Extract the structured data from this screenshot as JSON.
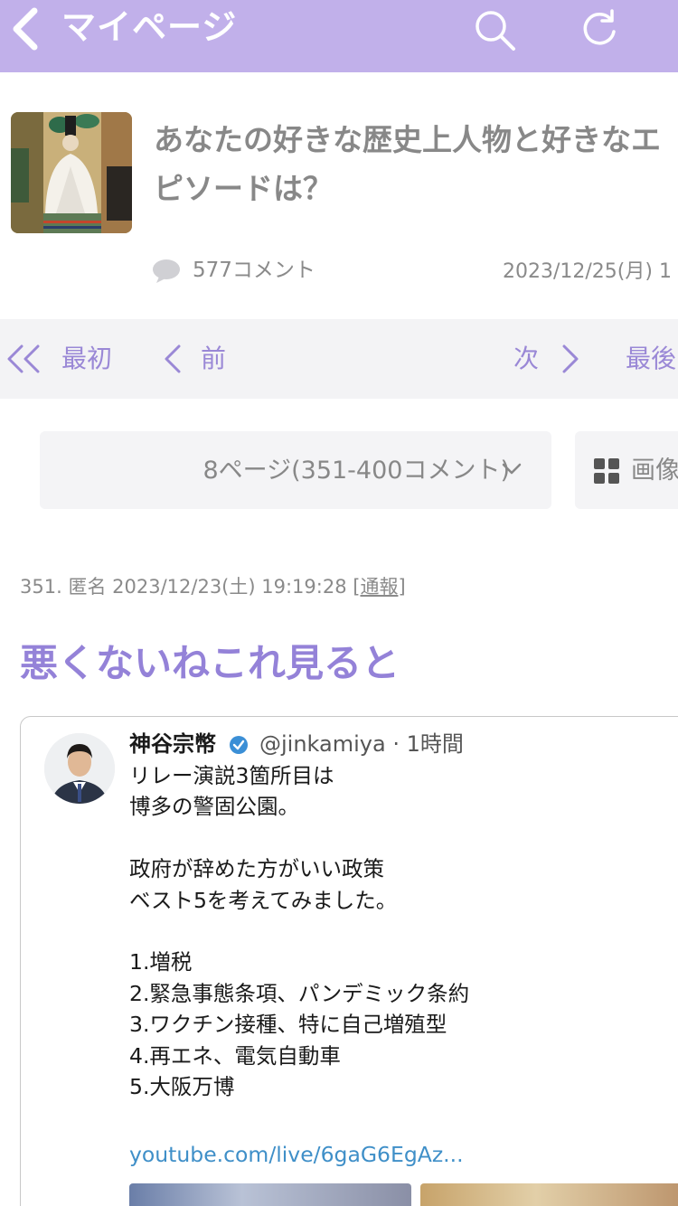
{
  "header": {
    "title": "マイページ",
    "bg_color": "#c1b0ea",
    "icons": [
      "chevron-left-icon",
      "search-icon",
      "refresh-icon"
    ]
  },
  "article": {
    "title_lines": [
      "あなたの好きな歴史上人物と好きなエ",
      "ピソードは？"
    ],
    "comment_count": "577コメント",
    "date": "2023/12/25(月) 1"
  },
  "pager": {
    "first": "最初",
    "prev": "前",
    "next": "次",
    "last": "最後",
    "accent_color": "#9a88d6"
  },
  "page_select": {
    "label": "8ページ(351-400コメント)",
    "image_button": "画像"
  },
  "comment": {
    "number": "351.",
    "author": "匿名",
    "datetime": "2023/12/23(土) 19:19:28",
    "report_open": "[",
    "report": "通報",
    "report_close": "]",
    "body": "悪くないねこれ見ると",
    "body_color": "#9482d8"
  },
  "tweet": {
    "name": "神谷宗幣",
    "handle": "@jinkamiya · 1時間",
    "lines": [
      "リレー演説3箇所目は",
      "博多の警固公園。",
      "",
      "政府が辞めた方がいい政策",
      "ベスト5を考えてみました。",
      "",
      "1.増税",
      "2.緊急事態条項、パンデミック条約",
      "3.ワクチン接種、特に自己増殖型",
      "4.再エネ、電気自動車",
      "5.大阪万博"
    ],
    "link": "youtube.com/live/6gaG6EgAz..."
  }
}
